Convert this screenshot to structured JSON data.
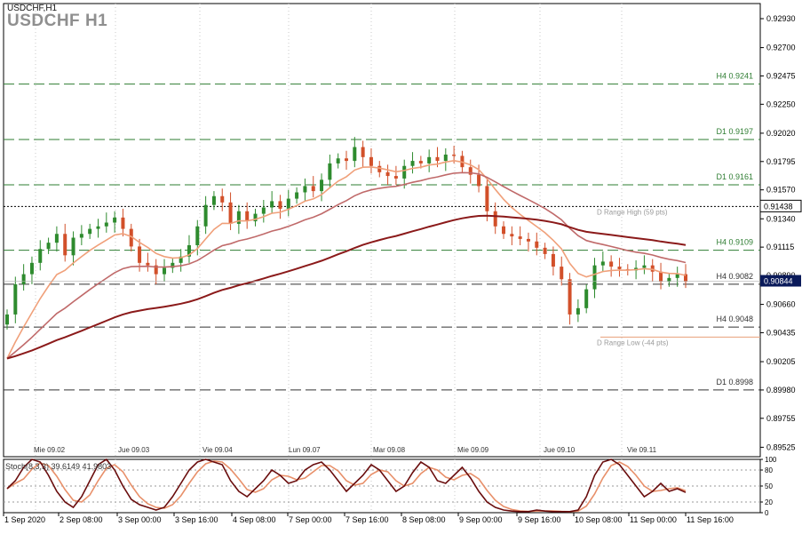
{
  "header": {
    "title": "USDCHF,H1",
    "watermark": "USDCHF H1"
  },
  "chart_data": {
    "type": "candlestick",
    "symbol": "USDCHF",
    "timeframe": "H1",
    "ylim": [
      0.8945,
      0.9305
    ],
    "y_ticks": [
      "0.92930",
      "0.92700",
      "0.92475",
      "0.92250",
      "0.92020",
      "0.91795",
      "0.91570",
      "0.91340",
      "0.91115",
      "0.90890",
      "0.90660",
      "0.90435",
      "0.90205",
      "0.89980",
      "0.89755",
      "0.89525"
    ],
    "current_price": "0.90844",
    "day_high_label": "0.91438",
    "top_date_labels": [
      "Mie 09.02",
      "Jue 09.03",
      "Vie 09.04",
      "Lun 09.07",
      "Mar 09.08",
      "Mie 09.09",
      "Jue 09.10",
      "Vie 09.11"
    ],
    "bottom_time_labels": [
      "1 Sep 2020",
      "2 Sep 08:00",
      "3 Sep 00:00",
      "3 Sep 16:00",
      "4 Sep 08:00",
      "7 Sep 00:00",
      "7 Sep 16:00",
      "8 Sep 08:00",
      "9 Sep 00:00",
      "9 Sep 16:00",
      "10 Sep 08:00",
      "11 Sep 00:00",
      "11 Sep 16:00"
    ],
    "levels": [
      {
        "label": "H4 0.9241",
        "value": 0.9241,
        "color": "#2e7d32"
      },
      {
        "label": "D1 0.9197",
        "value": 0.9197,
        "color": "#2e7d32"
      },
      {
        "label": "D1 0.9161",
        "value": 0.9161,
        "color": "#2e7d32"
      },
      {
        "label": "H4 0.9109",
        "value": 0.9109,
        "color": "#2e7d32"
      },
      {
        "label": "H4 0.9082",
        "value": 0.9082,
        "color": "#333333"
      },
      {
        "label": "H4 0.9048",
        "value": 0.9048,
        "color": "#333333"
      },
      {
        "label": "D1 0.8998",
        "value": 0.8998,
        "color": "#333333"
      }
    ],
    "day_range": {
      "high_label": "D Range High (59 pts)",
      "high_value": 0.91438,
      "low_label": "D Range Low (-44 pts)",
      "low_value": 0.904
    },
    "close_path": [
      0.9058,
      0.9082,
      0.909,
      0.9099,
      0.911,
      0.9115,
      0.9122,
      0.9105,
      0.9119,
      0.9122,
      0.9126,
      0.9128,
      0.9131,
      0.9135,
      0.9126,
      0.9112,
      0.9099,
      0.9097,
      0.909,
      0.9095,
      0.9099,
      0.9104,
      0.9113,
      0.9128,
      0.9145,
      0.9152,
      0.9147,
      0.913,
      0.914,
      0.9132,
      0.9138,
      0.9143,
      0.9148,
      0.9142,
      0.915,
      0.9155,
      0.916,
      0.9156,
      0.9165,
      0.9178,
      0.9182,
      0.918,
      0.9191,
      0.9183,
      0.9176,
      0.9171,
      0.9168,
      0.9166,
      0.9176,
      0.918,
      0.9178,
      0.9183,
      0.918,
      0.9185,
      0.9184,
      0.9175,
      0.9169,
      0.916,
      0.914,
      0.9128,
      0.9122,
      0.912,
      0.9118,
      0.9116,
      0.9111,
      0.9106,
      0.9096,
      0.9086,
      0.9058,
      0.9063,
      0.9078,
      0.9097,
      0.91,
      0.9096,
      0.9094,
      0.9093,
      0.9095,
      0.9097,
      0.9092,
      0.9084,
      0.9087,
      0.909,
      0.9084
    ],
    "series": [
      {
        "name": "",
        "color": "#f0a07a",
        "period": 8
      },
      {
        "name": "",
        "color": "#c06a6a",
        "period": 21
      },
      {
        "name": "",
        "color": "#8b1a1a",
        "period": 60
      }
    ],
    "stochastic": {
      "label": "Stoch(8,3,3) 39.6149 41.9803",
      "levels": [
        100,
        80,
        50,
        20,
        0
      ],
      "k_values": [
        45,
        60,
        85,
        100,
        95,
        70,
        40,
        20,
        10,
        30,
        60,
        90,
        100,
        80,
        50,
        25,
        15,
        10,
        5,
        10,
        30,
        55,
        80,
        95,
        100,
        95,
        90,
        60,
        40,
        30,
        45,
        60,
        80,
        70,
        55,
        60,
        80,
        90,
        95,
        80,
        60,
        40,
        55,
        70,
        90,
        80,
        60,
        40,
        50,
        75,
        95,
        85,
        60,
        55,
        70,
        85,
        65,
        40,
        20,
        10,
        5,
        3,
        2,
        2,
        5,
        3,
        2,
        2,
        2,
        5,
        30,
        70,
        95,
        100,
        90,
        70,
        50,
        30,
        40,
        55,
        40,
        45,
        38
      ]
    }
  }
}
